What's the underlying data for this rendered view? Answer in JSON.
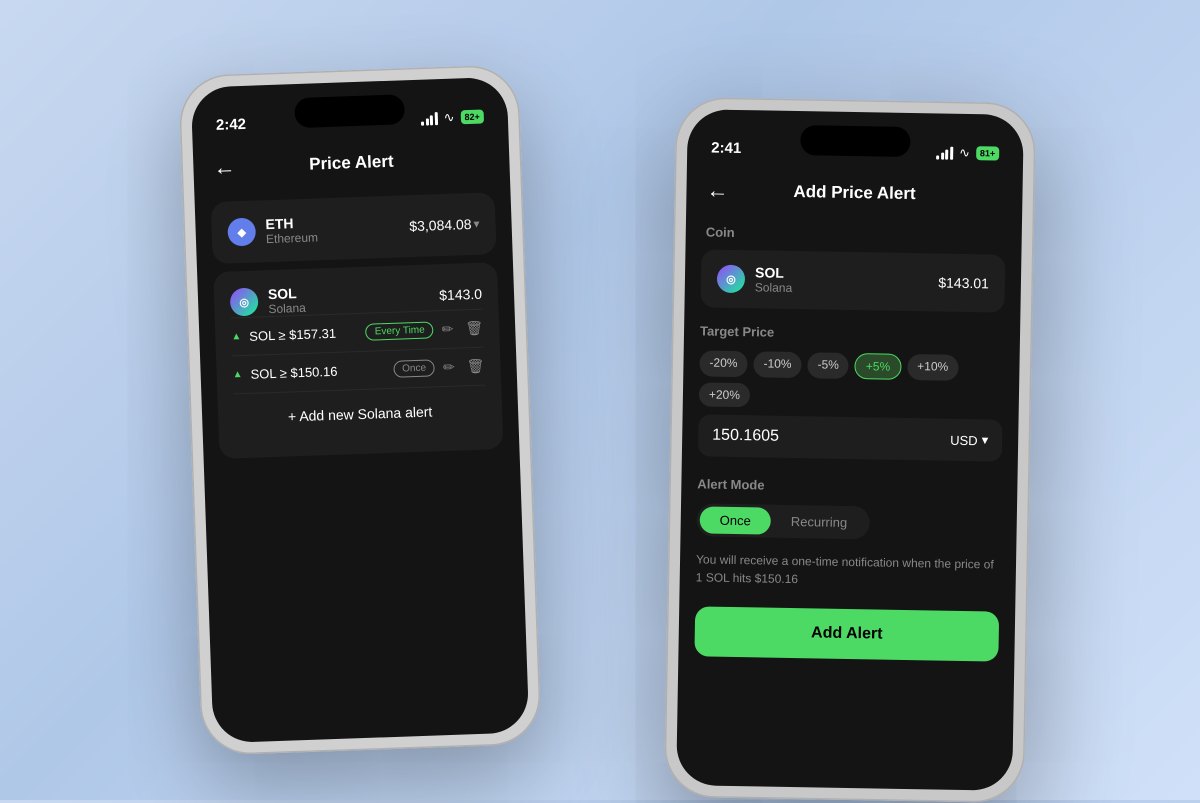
{
  "background": {
    "gradient_start": "#c8d8f0",
    "gradient_end": "#d0e0f8"
  },
  "phone_left": {
    "time": "2:42",
    "battery": "82+",
    "title": "Price Alert",
    "back_label": "←",
    "coins": [
      {
        "symbol": "ETH",
        "name": "Ethereum",
        "price": "$3,084.08",
        "icon": "◆"
      },
      {
        "symbol": "SOL",
        "name": "Solana",
        "price": "$143.0",
        "icon": "◎",
        "alerts": [
          {
            "text": "SOL ≥ $157.31",
            "badge": "Every Time",
            "badge_type": "active"
          },
          {
            "text": "SOL ≥ $150.16",
            "badge": "Once",
            "badge_type": "inactive"
          }
        ]
      }
    ],
    "add_alert_label": "+ Add new Solana alert"
  },
  "phone_right": {
    "time": "2:41",
    "battery": "81+",
    "title": "Add Price Alert",
    "back_label": "←",
    "sections": {
      "coin": {
        "label": "Coin",
        "symbol": "SOL",
        "name": "Solana",
        "price": "$143.01"
      },
      "target_price": {
        "label": "Target Price",
        "percentages": [
          "-20%",
          "-10%",
          "-5%",
          "+5%",
          "+10%",
          "+20%"
        ],
        "active_pct": "+5%",
        "value": "150.1605",
        "currency": "USD"
      },
      "alert_mode": {
        "label": "Alert Mode",
        "modes": [
          "Once",
          "Recurring"
        ],
        "active_mode": "Once",
        "description": "You will receive a one-time notification when the price of 1 SOL hits $150.16"
      }
    },
    "confirm_label": "Add Alert"
  }
}
